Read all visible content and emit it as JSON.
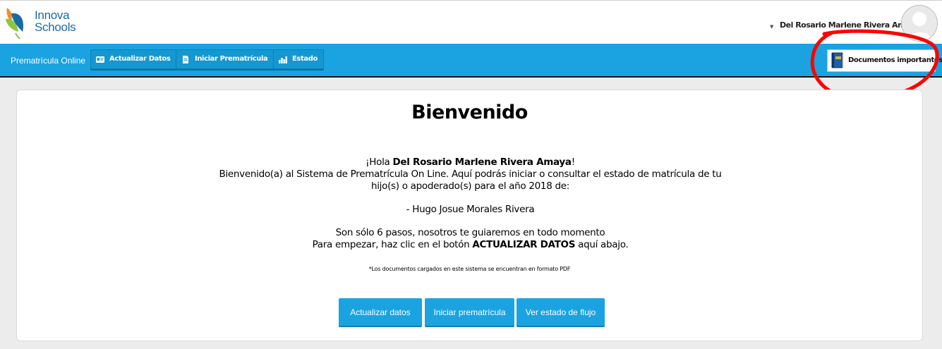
{
  "header": {
    "logo": {
      "line1": "Innova",
      "line2": "Schools"
    },
    "user_name": "Del Rosario Marlene Rivera Amaya"
  },
  "navbar": {
    "brand": "Prematrícula Online",
    "buttons": [
      {
        "label": "Actualizar Datos",
        "icon": "id-card-icon"
      },
      {
        "label": "Iniciar Prematrícula",
        "icon": "document-icon"
      },
      {
        "label": "Estado",
        "icon": "bar-chart-icon"
      }
    ],
    "documents_label": "Documentos importantes",
    "documents_icon": "book-icon"
  },
  "main": {
    "title": "Bienvenido",
    "greeting_prefix": "¡Hola ",
    "greeting_name": "Del Rosario Marlene Rivera Amaya",
    "greeting_suffix": "!",
    "intro_line1": "Bienvenido(a) al Sistema de Prematrícula On Line. Aquí podrás iniciar o consultar el estado de matrícula de tu",
    "intro_line2": "hijo(s) o apoderado(s) para el año 2018 de:",
    "student": "- Hugo Josue Morales Rivera",
    "steps_line": "Son sólo 6 pasos, nosotros te guiaremos en todo momento",
    "cta_prefix": "Para empezar, haz clic en el botón ",
    "cta_button_ref": "ACTUALIZAR DATOS",
    "cta_suffix": " aquí abajo.",
    "note": "*Los documentos cargados en este sistema se encuentran en formato PDF",
    "actions": {
      "update": "Actualizar datos",
      "start": "Iniciar prematrícula",
      "status": "Ver estado de flujo"
    }
  },
  "colors": {
    "primary": "#1aa3e0",
    "logo_blue": "#1a6aa8",
    "annotation": "#ff0000"
  }
}
